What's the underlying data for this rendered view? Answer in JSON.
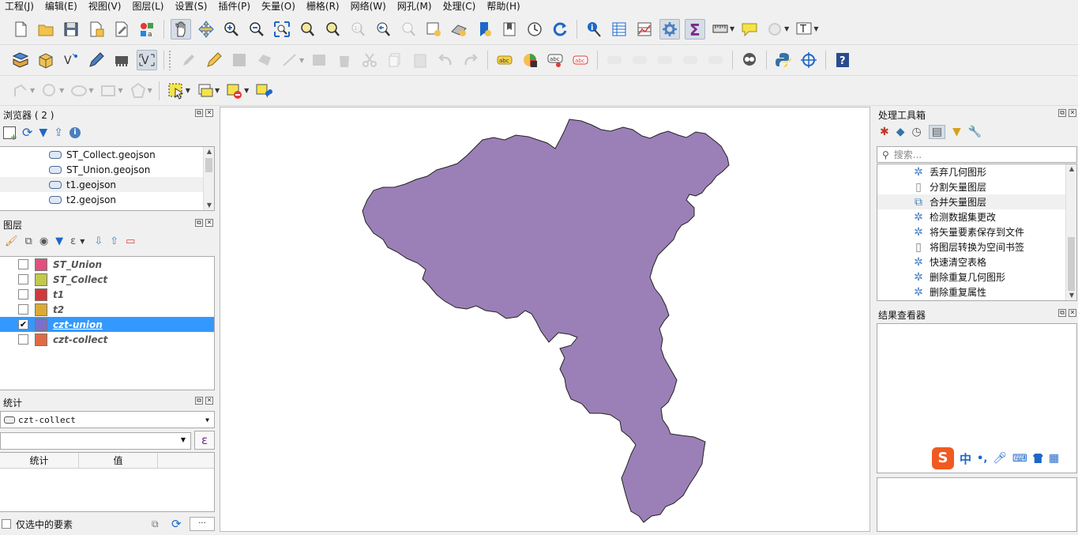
{
  "menu": [
    "工程(J)",
    "编辑(E)",
    "视图(V)",
    "图层(L)",
    "设置(S)",
    "插件(P)",
    "矢量(O)",
    "栅格(R)",
    "网络(W)",
    "网孔(M)",
    "处理(C)",
    "帮助(H)"
  ],
  "browser": {
    "title": "浏览器 ( 2 )",
    "items": [
      "ST_Collect.geojson",
      "ST_Union.geojson",
      "t1.geojson",
      "t2.geojson"
    ],
    "selected_index": 2
  },
  "layers": {
    "title": "图层",
    "items": [
      {
        "name": "ST_Union",
        "color": "#e0507e",
        "checked": false
      },
      {
        "name": "ST_Collect",
        "color": "#c3c94a",
        "checked": false
      },
      {
        "name": "t1",
        "color": "#d03a3a",
        "checked": false
      },
      {
        "name": "t2",
        "color": "#dcaa34",
        "checked": false
      },
      {
        "name": "czt-union",
        "color": "#7b6fcd",
        "checked": true
      },
      {
        "name": "czt-collect",
        "color": "#e06a44",
        "checked": false
      }
    ],
    "selected_index": 4
  },
  "stats": {
    "title": "统计",
    "layer_select": "czt-collect",
    "field_value": "",
    "columns": [
      "统计",
      "值"
    ],
    "selected_only_label": "仅选中的要素",
    "more_label": "···"
  },
  "toolbox": {
    "title": "处理工具箱",
    "search_placeholder": "搜索...",
    "items": [
      {
        "label": "丢弃几何图形",
        "icon": "gear-icon"
      },
      {
        "label": "分割矢量图层",
        "icon": "split-icon"
      },
      {
        "label": "合并矢量图层",
        "icon": "merge-icon"
      },
      {
        "label": "检测数据集更改",
        "icon": "gear-icon"
      },
      {
        "label": "将矢量要素保存到文件",
        "icon": "gear-icon"
      },
      {
        "label": "将图层转换为空间书签",
        "icon": "bookmark-icon"
      },
      {
        "label": "快速清空表格",
        "icon": "gear-icon"
      },
      {
        "label": "删除重复几何图形",
        "icon": "gear-icon"
      },
      {
        "label": "删除重复属性",
        "icon": "gear-icon"
      }
    ],
    "selected_index": 2
  },
  "results": {
    "title": "结果查看器"
  },
  "ime": {
    "logo": "S",
    "mode": "中",
    "punct": "•,"
  },
  "map": {
    "fill_color": "#9b80b7",
    "stroke_color": "#222222"
  }
}
